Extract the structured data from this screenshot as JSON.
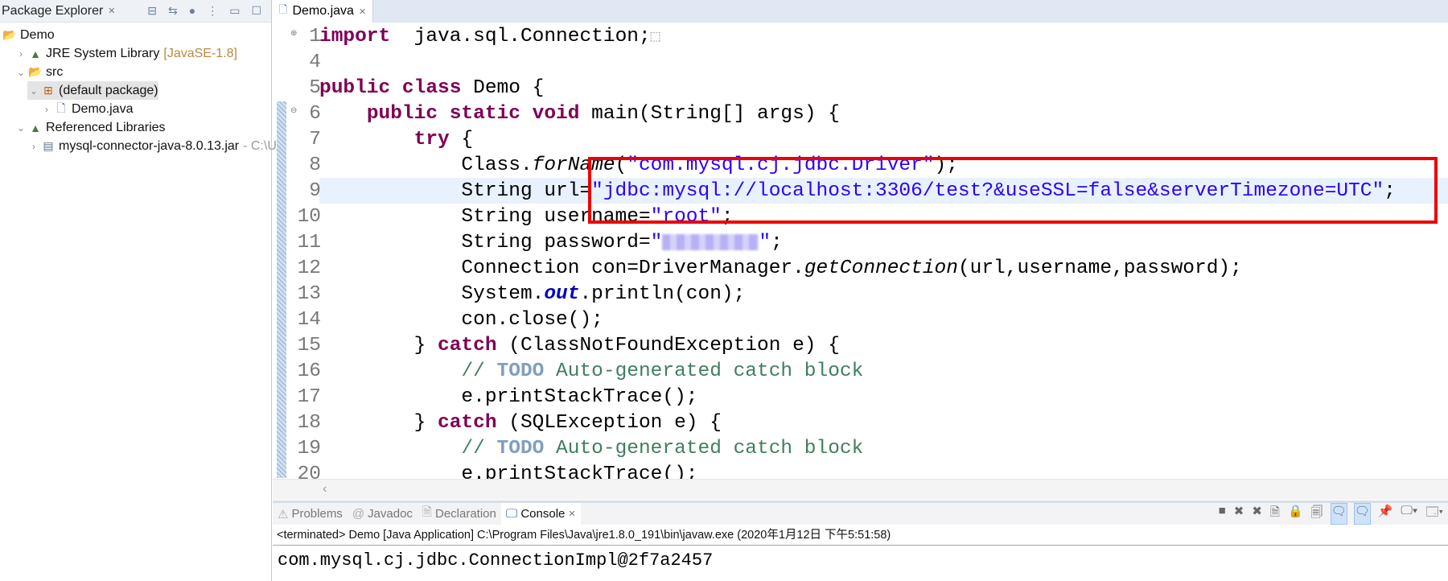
{
  "package_explorer": {
    "title": "Package Explorer",
    "items": [
      {
        "label": "Demo",
        "icon": "project-icon",
        "level": 0,
        "arrow": ""
      },
      {
        "label": "JRE System Library",
        "deco": "[JavaSE-1.8]",
        "icon": "library-icon",
        "level": 1,
        "arrow": "›"
      },
      {
        "label": "src",
        "icon": "source-folder-icon",
        "level": 1,
        "arrow": "⌄"
      },
      {
        "label": "(default package)",
        "icon": "package-icon",
        "level": 2,
        "arrow": "⌄",
        "selected": true
      },
      {
        "label": "Demo.java",
        "icon": "java-file-icon",
        "level": 3,
        "arrow": "›"
      },
      {
        "label": "Referenced Libraries",
        "icon": "library-icon",
        "level": 1,
        "arrow": "⌄"
      },
      {
        "label": "mysql-connector-java-8.0.13.jar",
        "deco": "- C:\\U",
        "icon": "jar-icon",
        "level": 2,
        "arrow": "›"
      }
    ]
  },
  "editor": {
    "tab": "Demo.java",
    "lines": [
      {
        "n": "1",
        "fold": "⊕",
        "t": [
          [
            "kw",
            "import"
          ],
          [
            "",
            "  java.sql.Connection;"
          ],
          [
            "box",
            "⬚"
          ]
        ]
      },
      {
        "n": "4",
        "t": []
      },
      {
        "n": "5",
        "t": [
          [
            "kw",
            "public"
          ],
          [
            "",
            " "
          ],
          [
            "kw",
            "class"
          ],
          [
            "",
            " Demo {"
          ]
        ]
      },
      {
        "n": "6",
        "fold": "⊖",
        "t": [
          [
            "",
            "    "
          ],
          [
            "kw",
            "public"
          ],
          [
            "",
            " "
          ],
          [
            "kw",
            "static"
          ],
          [
            "",
            " "
          ],
          [
            "kw",
            "void"
          ],
          [
            "",
            " main(String[] args) {"
          ]
        ]
      },
      {
        "n": "7",
        "t": [
          [
            "",
            "        "
          ],
          [
            "kw",
            "try"
          ],
          [
            "",
            " {"
          ]
        ]
      },
      {
        "n": "8",
        "t": [
          [
            "",
            "            Class."
          ],
          [
            "it",
            "forName"
          ],
          [
            "",
            "("
          ],
          [
            "str",
            "\"com.mysql.cj.jdbc.Driver\""
          ],
          [
            "",
            ");"
          ]
        ]
      },
      {
        "n": "9",
        "t": [
          [
            "",
            "            String url="
          ],
          [
            "str",
            "\"jdbc:mysql://localhost:3306/test?&useSSL=false&serverTimezone=UTC\""
          ],
          [
            "",
            ";"
          ]
        ]
      },
      {
        "n": "10",
        "t": [
          [
            "",
            "            String username="
          ],
          [
            "str",
            "\"root\""
          ],
          [
            "",
            ";"
          ]
        ]
      },
      {
        "n": "11",
        "t": [
          [
            "",
            "            String password="
          ],
          [
            "str",
            "\""
          ],
          [
            "blur",
            ""
          ],
          [
            "str",
            "\""
          ],
          [
            "",
            ";"
          ]
        ]
      },
      {
        "n": "12",
        "t": [
          [
            "",
            "            Connection con=DriverManager."
          ],
          [
            "it",
            "getConnection"
          ],
          [
            "",
            "(url,username,password);"
          ]
        ]
      },
      {
        "n": "13",
        "t": [
          [
            "",
            "            System."
          ],
          [
            "fld",
            "out"
          ],
          [
            "",
            ".println(con);"
          ]
        ]
      },
      {
        "n": "14",
        "t": [
          [
            "",
            "            con.close();"
          ]
        ]
      },
      {
        "n": "15",
        "t": [
          [
            "",
            "        } "
          ],
          [
            "kw",
            "catch"
          ],
          [
            "",
            " (ClassNotFoundException e) {"
          ]
        ]
      },
      {
        "n": "16",
        "t": [
          [
            "",
            "            "
          ],
          [
            "cm",
            "// "
          ],
          [
            "todo",
            "TODO"
          ],
          [
            "cm",
            " Auto-generated catch block"
          ]
        ]
      },
      {
        "n": "17",
        "t": [
          [
            "",
            "            e.printStackTrace();"
          ]
        ]
      },
      {
        "n": "18",
        "t": [
          [
            "",
            "        } "
          ],
          [
            "kw",
            "catch"
          ],
          [
            "",
            " (SQLException e) {"
          ]
        ]
      },
      {
        "n": "19",
        "t": [
          [
            "",
            "            "
          ],
          [
            "cm",
            "// "
          ],
          [
            "todo",
            "TODO"
          ],
          [
            "cm",
            " Auto-generated catch block"
          ]
        ]
      },
      {
        "n": "20",
        "t": [
          [
            "",
            "            e.printStackTrace();"
          ]
        ]
      }
    ],
    "scroll_left": "‹"
  },
  "console": {
    "tabs": [
      {
        "label": "Problems",
        "icon": "problems-icon"
      },
      {
        "label": "Javadoc",
        "icon": "javadoc-icon"
      },
      {
        "label": "Declaration",
        "icon": "declaration-icon"
      },
      {
        "label": "Console",
        "icon": "console-icon",
        "active": true
      }
    ],
    "status": "<terminated> Demo [Java Application] C:\\Program Files\\Java\\jre1.8.0_191\\bin\\javaw.exe (2020年1月12日 下午5:51:58)",
    "output": "com.mysql.cj.jdbc.ConnectionImpl@2f7a2457"
  },
  "colors": {
    "keyword": "#7f0055",
    "string": "#2a00ff",
    "comment": "#3f7f5f",
    "highlight": "#ee0000"
  }
}
